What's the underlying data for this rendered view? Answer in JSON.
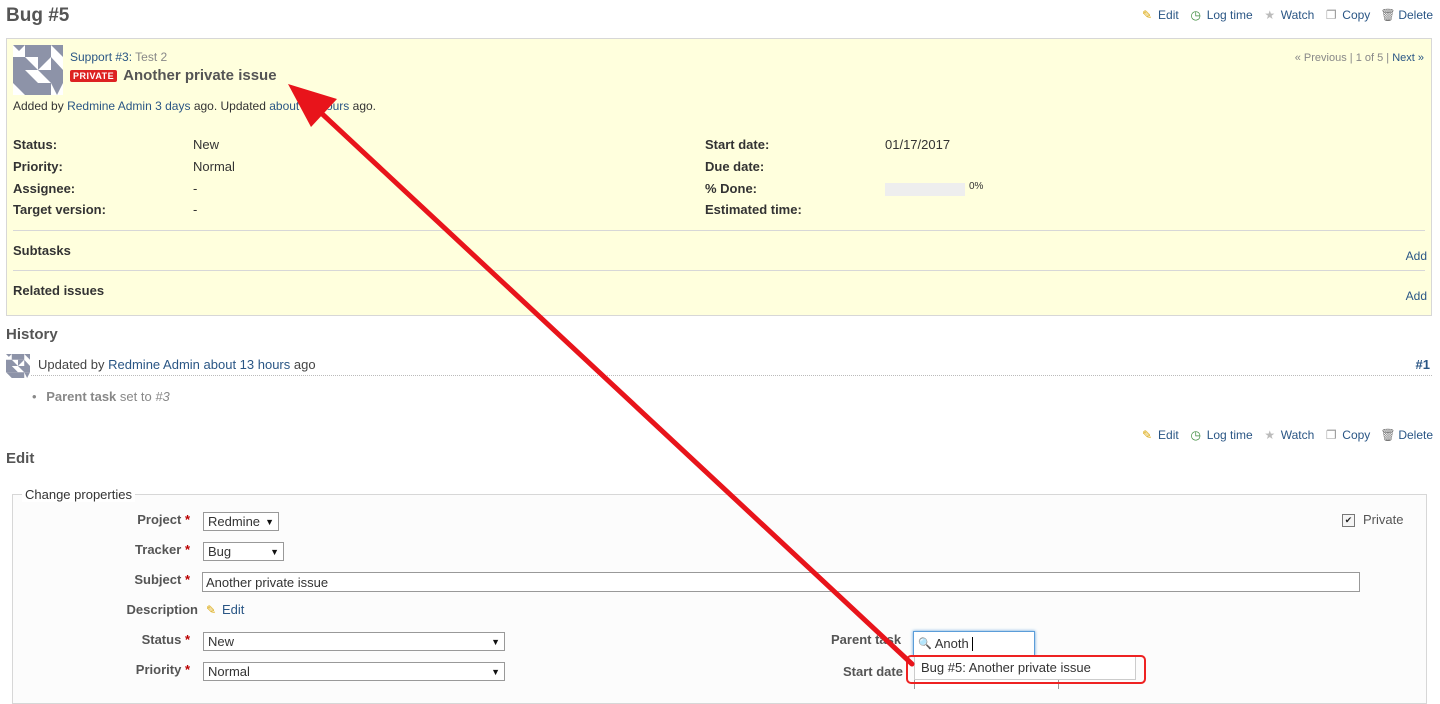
{
  "page": {
    "title": "Bug #5"
  },
  "actions": {
    "edit": "Edit",
    "log_time": "Log time",
    "watch": "Watch",
    "copy": "Copy",
    "delete": "Delete"
  },
  "issue": {
    "parent_link": "Support #3:",
    "parent_subject": "Test 2",
    "private_badge": "PRIVATE",
    "subject": "Another private issue",
    "nav": {
      "previous": "« Previous",
      "position": "| 1 of 5 |",
      "next": "Next »"
    },
    "author": {
      "prefix": "Added by",
      "name": "Redmine Admin",
      "created": "3 days",
      "mid": "ago. Updated",
      "updated": "about 13 hours",
      "suffix": "ago."
    },
    "attributes_left": [
      {
        "label": "Status:",
        "value": "New"
      },
      {
        "label": "Priority:",
        "value": "Normal"
      },
      {
        "label": "Assignee:",
        "value": "-"
      },
      {
        "label": "Target version:",
        "value": "-"
      }
    ],
    "attributes_right": [
      {
        "label": "Start date:",
        "value": "01/17/2017"
      },
      {
        "label": "Due date:",
        "value": ""
      },
      {
        "label": "% Done:",
        "value": "0%"
      },
      {
        "label": "Estimated time:",
        "value": ""
      }
    ],
    "done_ratio": 0,
    "subtasks": {
      "title": "Subtasks",
      "add": "Add"
    },
    "relations": {
      "title": "Related issues",
      "add": "Add"
    }
  },
  "history": {
    "title": "History",
    "journal": {
      "prefix": "Updated by",
      "user": "Redmine Admin",
      "when": "about 13 hours",
      "suffix": "ago",
      "number": "#1"
    },
    "detail": {
      "field": "Parent task",
      "text": "set to",
      "value": "#3"
    }
  },
  "edit": {
    "title": "Edit",
    "legend": "Change properties",
    "project": {
      "label": "Project",
      "value": "Redmine"
    },
    "tracker": {
      "label": "Tracker",
      "value": "Bug"
    },
    "subject": {
      "label": "Subject",
      "value": "Another private issue"
    },
    "description": {
      "label": "Description",
      "edit": "Edit"
    },
    "status": {
      "label": "Status",
      "value": "New"
    },
    "priority": {
      "label": "Priority",
      "value": "Normal"
    },
    "private": {
      "label": "Private",
      "checked": true
    },
    "parent_task": {
      "label": "Parent task",
      "value": "Anoth"
    },
    "start_date": {
      "label": "Start date"
    },
    "autocomplete": {
      "item": "Bug #5: Another private issue"
    }
  },
  "colors": {
    "annotation": "#e8141b",
    "link": "#2a5685",
    "issue_bg": "#ffffdd"
  }
}
